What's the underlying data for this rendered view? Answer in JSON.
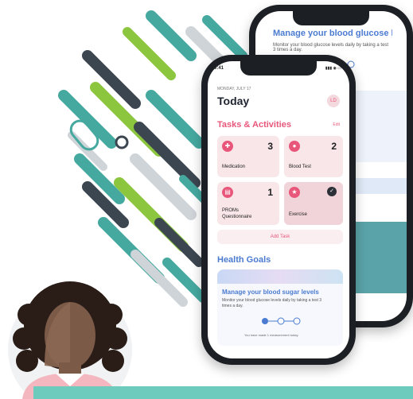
{
  "colors": {
    "accent": "#e8577a",
    "teal": "#45a9a0",
    "lime": "#8cc63f",
    "goal_blue": "#4a7bd1",
    "band": "#6ccbbd"
  },
  "back_phone": {
    "goal_title": "Manage your blood glucose levels",
    "goal_text": "Monitor your blood glucose levels daily by taking a test 3 times a day."
  },
  "front_phone": {
    "status_time": "9:41",
    "date": "MONDAY, JULY 17",
    "title": "Today",
    "avatar_initials": "LD",
    "section_tasks": "Tasks & Activities",
    "edit_label": "Edit",
    "tasks": [
      {
        "label": "Medication",
        "count": "3",
        "icon": "pills-icon"
      },
      {
        "label": "Blood Test",
        "count": "2",
        "icon": "blood-drop-icon"
      },
      {
        "label": "PROMs\nQuestionnaire",
        "count": "1",
        "icon": "clipboard-icon"
      },
      {
        "label": "Exercise",
        "count": "",
        "icon": "exercise-icon",
        "completed": true
      }
    ],
    "add_task": "Add Task",
    "section_goals": "Health Goals",
    "goal_title": "Manage your blood sugar levels",
    "goal_text": "Monitor your blood glucose levels daily by taking a test 3 times a day.",
    "goal_progress_text": "You have made 1 measurement today.",
    "goal_progress_steps": 3,
    "goal_progress_done": 1
  }
}
